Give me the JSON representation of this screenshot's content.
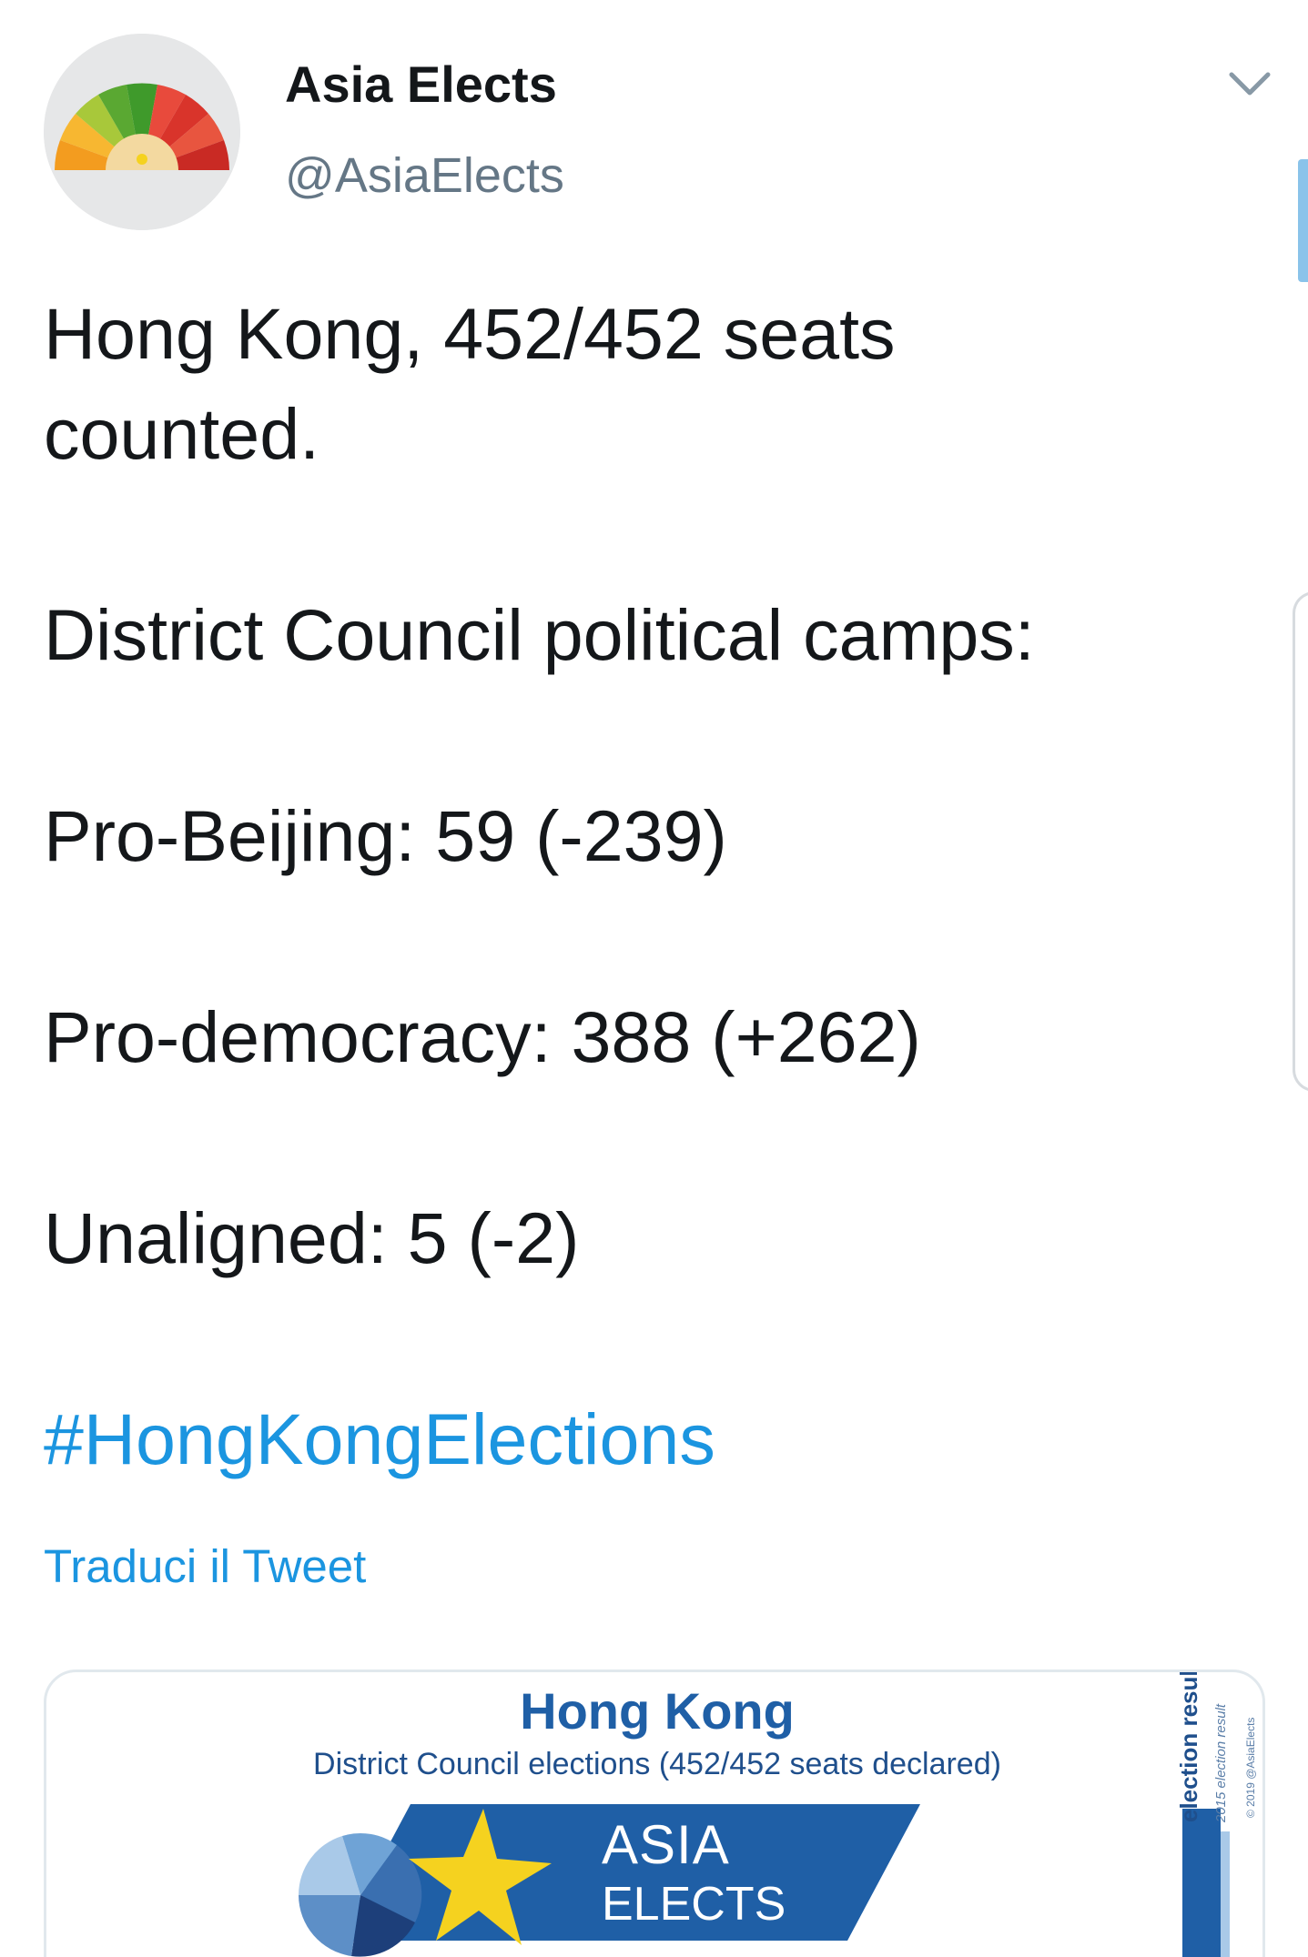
{
  "author": {
    "display_name": "Asia Elects",
    "handle": "@AsiaElects"
  },
  "tweet": {
    "lines": {
      "l1": "Hong Kong, 452/452 seats",
      "l2": "counted.",
      "l3": "District Council political camps:",
      "l4": "Pro-Beijing: 59 (-239)",
      "l5": "Pro-democracy: 388 (+262)",
      "l6": "Unaligned: 5 (-2)"
    },
    "hashtag": "#HongKongElections",
    "translate_label": "Traduci il Tweet"
  },
  "media": {
    "title": "Hong Kong",
    "subtitle": "District Council elections (452/452 seats declared)",
    "brand_line_1": "ASIA",
    "brand_line_2": "ELECTS",
    "side_label": "election result",
    "side_sub": "2015 election result",
    "side_copy": "© 2019 @AsiaElects"
  },
  "colors": {
    "link": "#1b95e0",
    "text": "#14171a",
    "secondary": "#657786",
    "banner_blue": "#1f5fa6",
    "star_yellow": "#f5d21f"
  },
  "icons": {
    "caret": "chevron-down-icon",
    "avatar": "asia-elects-fan-logo"
  }
}
